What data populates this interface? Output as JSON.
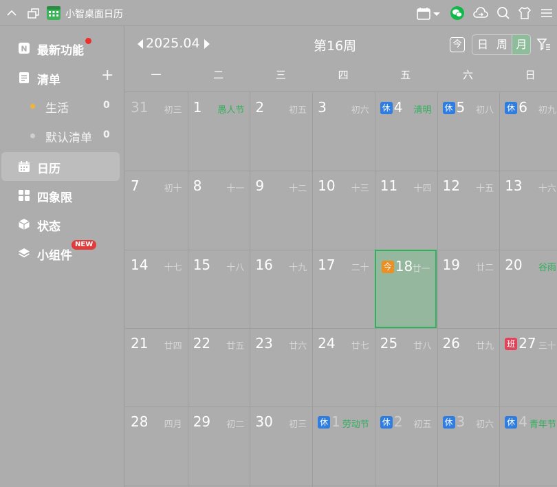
{
  "app": {
    "title": "小智桌面日历"
  },
  "sidebar": {
    "items": [
      {
        "label": "最新功能",
        "icon": "new-icon"
      },
      {
        "label": "清单",
        "icon": "list-icon",
        "add": "+"
      },
      {
        "label": "日历",
        "icon": "calendar-icon",
        "active": true
      },
      {
        "label": "四象限",
        "icon": "grid-icon"
      },
      {
        "label": "状态",
        "icon": "cube-icon"
      },
      {
        "label": "小组件",
        "icon": "layers-icon",
        "badge": "NEW"
      }
    ],
    "lists": [
      {
        "label": "生活",
        "count": "0",
        "color": "#f2b33d"
      },
      {
        "label": "默认清单",
        "count": "0",
        "color": "#cfcfcf"
      }
    ]
  },
  "calendar": {
    "month": "2025.04",
    "week": "第16周",
    "today_label": "今",
    "views": [
      "日",
      "周",
      "月"
    ],
    "active_view": "月",
    "weekdays": [
      "一",
      "二",
      "三",
      "四",
      "五",
      "六",
      "日"
    ],
    "weeks": [
      [
        {
          "day": "31",
          "lunar": "初三",
          "dim": true
        },
        {
          "day": "1",
          "lunar": "愚人节",
          "festival": true
        },
        {
          "day": "2",
          "lunar": "初五"
        },
        {
          "day": "3",
          "lunar": "初六"
        },
        {
          "day": "4",
          "lunar": "清明",
          "festival": true,
          "badge": "休",
          "badge_type": "rest"
        },
        {
          "day": "5",
          "lunar": "初八",
          "badge": "休",
          "badge_type": "rest"
        },
        {
          "day": "6",
          "lunar": "初九",
          "badge": "休",
          "badge_type": "rest"
        }
      ],
      [
        {
          "day": "7",
          "lunar": "初十"
        },
        {
          "day": "8",
          "lunar": "十一"
        },
        {
          "day": "9",
          "lunar": "十二"
        },
        {
          "day": "10",
          "lunar": "十三"
        },
        {
          "day": "11",
          "lunar": "十四"
        },
        {
          "day": "12",
          "lunar": "十五"
        },
        {
          "day": "13",
          "lunar": "十六"
        }
      ],
      [
        {
          "day": "14",
          "lunar": "十七"
        },
        {
          "day": "15",
          "lunar": "十八"
        },
        {
          "day": "16",
          "lunar": "十九"
        },
        {
          "day": "17",
          "lunar": "二十"
        },
        {
          "day": "18",
          "lunar": "廿一",
          "badge": "今",
          "badge_type": "today",
          "today": true
        },
        {
          "day": "19",
          "lunar": "廿二"
        },
        {
          "day": "20",
          "lunar": "谷雨",
          "festival": true
        }
      ],
      [
        {
          "day": "21",
          "lunar": "廿四"
        },
        {
          "day": "22",
          "lunar": "廿五"
        },
        {
          "day": "23",
          "lunar": "廿六"
        },
        {
          "day": "24",
          "lunar": "廿七"
        },
        {
          "day": "25",
          "lunar": "廿八"
        },
        {
          "day": "26",
          "lunar": "廿九"
        },
        {
          "day": "27",
          "lunar": "三十",
          "badge": "班",
          "badge_type": "work"
        }
      ],
      [
        {
          "day": "28",
          "lunar": "四月"
        },
        {
          "day": "29",
          "lunar": "初二"
        },
        {
          "day": "30",
          "lunar": "初三"
        },
        {
          "day": "1",
          "lunar": "劳动节",
          "festival": true,
          "badge": "休",
          "badge_type": "rest",
          "dim": true
        },
        {
          "day": "2",
          "lunar": "初五",
          "badge": "休",
          "badge_type": "rest",
          "dim": true
        },
        {
          "day": "3",
          "lunar": "初六",
          "badge": "休",
          "badge_type": "rest",
          "dim": true
        },
        {
          "day": "4",
          "lunar": "青年节",
          "festival": true,
          "badge": "休",
          "badge_type": "rest",
          "dim": true
        }
      ]
    ]
  }
}
